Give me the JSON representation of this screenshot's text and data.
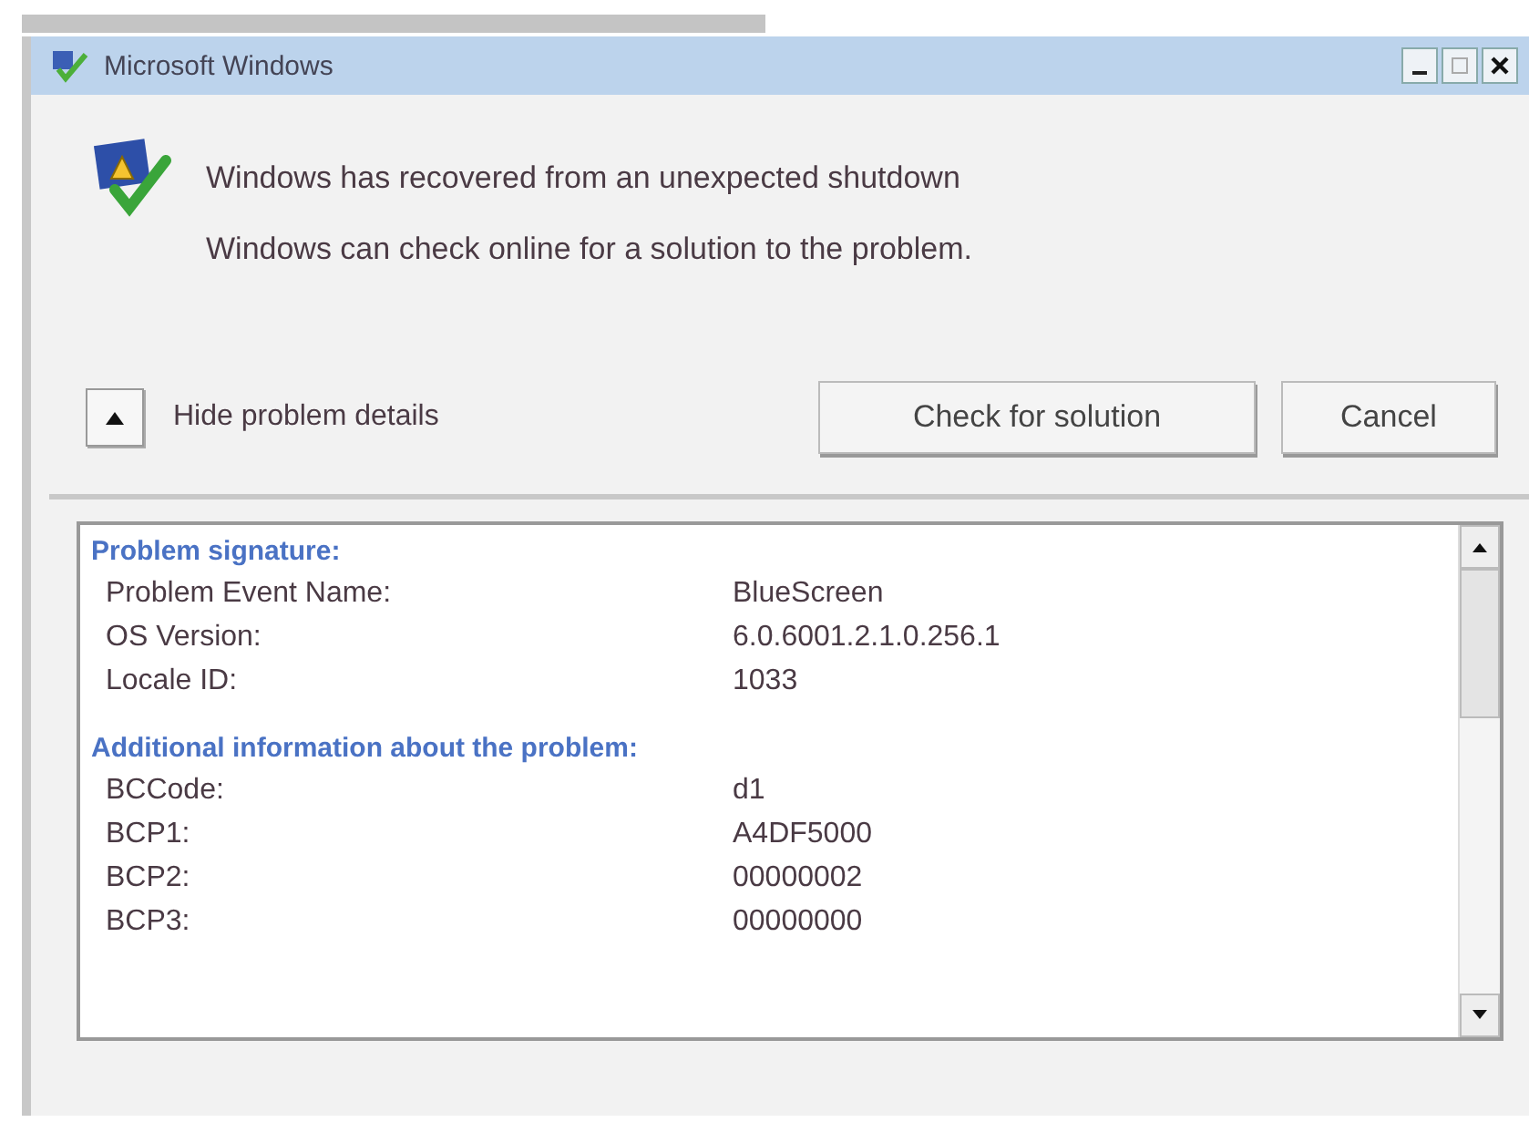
{
  "window": {
    "title": "Microsoft Windows"
  },
  "messages": [
    "Windows has recovered from an unexpected shutdown",
    "Windows can check online for a solution to the problem."
  ],
  "details_toggle": {
    "label": "Hide problem details",
    "expanded": true
  },
  "buttons": [
    "Check for solution",
    "Cancel"
  ],
  "details": [
    {
      "heading": "Problem signature:",
      "rows": [
        {
          "name": "Problem Event Name:",
          "value": "BlueScreen"
        },
        {
          "name": "OS Version:",
          "value": "6.0.6001.2.1.0.256.1"
        },
        {
          "name": "Locale ID:",
          "value": "1033"
        }
      ]
    },
    {
      "heading": "Additional information about the problem:",
      "rows": [
        {
          "name": "BCCode:",
          "value": "d1"
        },
        {
          "name": "BCP1:",
          "value": "A4DF5000"
        },
        {
          "name": "BCP2:",
          "value": "00000002"
        },
        {
          "name": "BCP3:",
          "value": "00000000"
        }
      ]
    }
  ]
}
